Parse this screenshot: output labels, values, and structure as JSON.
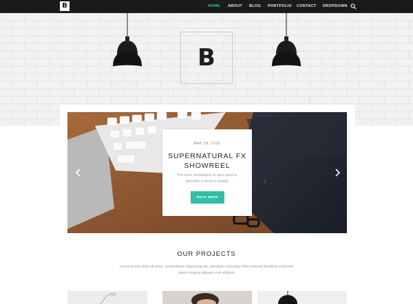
{
  "nav": {
    "logo": "B",
    "items": [
      {
        "label": "HOME",
        "active": true
      },
      {
        "label": "ABOUT",
        "active": false
      },
      {
        "label": "BLOG",
        "active": false
      },
      {
        "label": "PORTFOLIO",
        "active": false
      },
      {
        "label": "CONTACT",
        "active": false
      },
      {
        "label": "DROPDOWN",
        "active": false
      }
    ],
    "search_icon": "search-icon"
  },
  "hero": {
    "brand_letter": "B"
  },
  "slide": {
    "date": "MAY 29, 2015",
    "title_line1": "SUPERNATURAL FX",
    "title_line2": "SHOWREEL",
    "text_line1": "The term minimalism is also used to",
    "text_line2": "describe a trend in design",
    "button": "READ MORE",
    "prev_icon": "chevron-left-icon",
    "next_icon": "chevron-right-icon"
  },
  "projects": {
    "title": "OUR PROJECTS",
    "text_line1": "Lorem ipsum dolor sit amet, consectetuer adipiscing elit, sed diam nonummy nibh euismod tincidunt ut laoreet",
    "text_line2": "dolore magna aliquam erat volutpat"
  },
  "colors": {
    "accent": "#34c2b0",
    "button": "#2fc0a6",
    "nav_bg": "#1b1b1b"
  }
}
